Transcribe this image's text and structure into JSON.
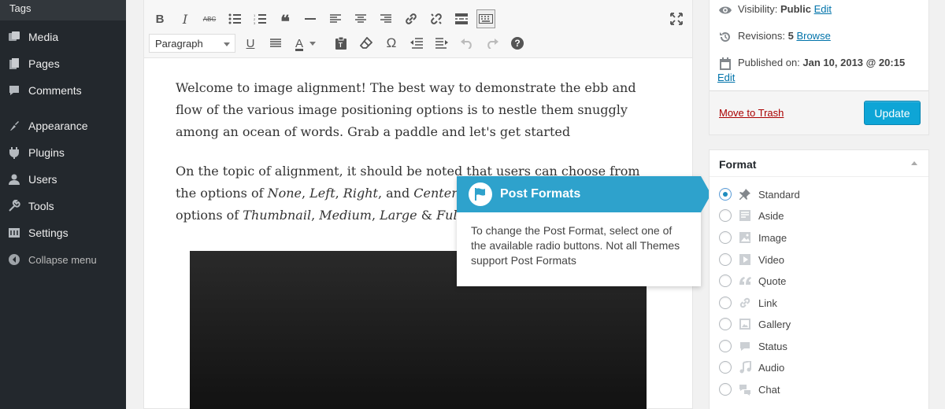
{
  "sidebar": {
    "top_item": "Tags",
    "items": [
      {
        "label": "Media",
        "icon": "media-icon"
      },
      {
        "label": "Pages",
        "icon": "pages-icon"
      },
      {
        "label": "Comments",
        "icon": "comments-icon"
      },
      {
        "label": "Appearance",
        "icon": "appearance-icon"
      },
      {
        "label": "Plugins",
        "icon": "plugins-icon"
      },
      {
        "label": "Users",
        "icon": "users-icon"
      },
      {
        "label": "Tools",
        "icon": "tools-icon"
      },
      {
        "label": "Settings",
        "icon": "settings-icon"
      }
    ],
    "collapse_label": "Collapse menu"
  },
  "toolbar": {
    "format_value": "Paragraph",
    "row1_icons": [
      "bold-icon",
      "italic-icon",
      "strikethrough-icon",
      "bullet-list-icon",
      "numbered-list-icon",
      "blockquote-icon",
      "horizontal-line-icon",
      "align-left-icon",
      "align-center-icon",
      "align-right-icon",
      "link-icon",
      "unlink-icon",
      "read-more-icon",
      "toolbar-toggle-icon"
    ],
    "row2_icons": [
      "underline-icon",
      "justify-icon",
      "text-color-icon",
      "paste-text-icon",
      "clear-formatting-icon",
      "special-character-icon",
      "outdent-icon",
      "indent-icon",
      "undo-icon",
      "redo-icon",
      "help-icon"
    ],
    "fullscreen_icon": "fullscreen-icon",
    "labels": {
      "bold": "B",
      "italic": "I",
      "strike": "ABC",
      "quote": "❝",
      "underline": "U",
      "color": "A",
      "omega": "Ω",
      "help": "?"
    }
  },
  "content": {
    "p1": "Welcome to image alignment! The best way to demonstrate the ebb and flow of the various image positioning options is to nestle them snuggly among an ocean of words. Grab a paddle and let's get started",
    "p2_a": "On the topic of alignment, it should be noted that users can choose from the options of ",
    "p2_none": "None",
    "p2_sep1": ", ",
    "p2_left": "Left",
    "p2_sep2": ", ",
    "p2_right": "Right",
    "p2_and": ", and ",
    "p2_center": "Center",
    "p2_b": ". In addition, they also get the options of ",
    "p2_thumb": "Thumbnail",
    "p2_sep3": ", ",
    "p2_medium": "Medium",
    "p2_sep4": ", ",
    "p2_large": "Large",
    "p2_amp": " & ",
    "p2_full": "Fullsize",
    "p2_end": "."
  },
  "pointer": {
    "title": "Post Formats",
    "body": "To change the Post Format, select one of the available radio buttons. Not all Themes support Post Formats",
    "color": "#2ea2cc"
  },
  "publish": {
    "visibility_label": "Visibility:",
    "visibility_value": "Public",
    "visibility_edit": "Edit",
    "revisions_label": "Revisions:",
    "revisions_value": "5",
    "revisions_link": "Browse",
    "published_label": "Published on:",
    "published_value": "Jan 10, 2013 @ 20:15",
    "published_edit": "Edit",
    "trash_label": "Move to Trash",
    "update_label": "Update"
  },
  "format_box": {
    "title": "Format",
    "options": [
      {
        "label": "Standard",
        "icon": "pin-icon",
        "checked": true
      },
      {
        "label": "Aside",
        "icon": "aside-icon",
        "checked": false
      },
      {
        "label": "Image",
        "icon": "image-icon",
        "checked": false
      },
      {
        "label": "Video",
        "icon": "video-icon",
        "checked": false
      },
      {
        "label": "Quote",
        "icon": "quote-icon",
        "checked": false
      },
      {
        "label": "Link",
        "icon": "link-icon",
        "checked": false
      },
      {
        "label": "Gallery",
        "icon": "gallery-icon",
        "checked": false
      },
      {
        "label": "Status",
        "icon": "status-icon",
        "checked": false
      },
      {
        "label": "Audio",
        "icon": "audio-icon",
        "checked": false
      },
      {
        "label": "Chat",
        "icon": "chat-icon",
        "checked": false
      }
    ]
  }
}
